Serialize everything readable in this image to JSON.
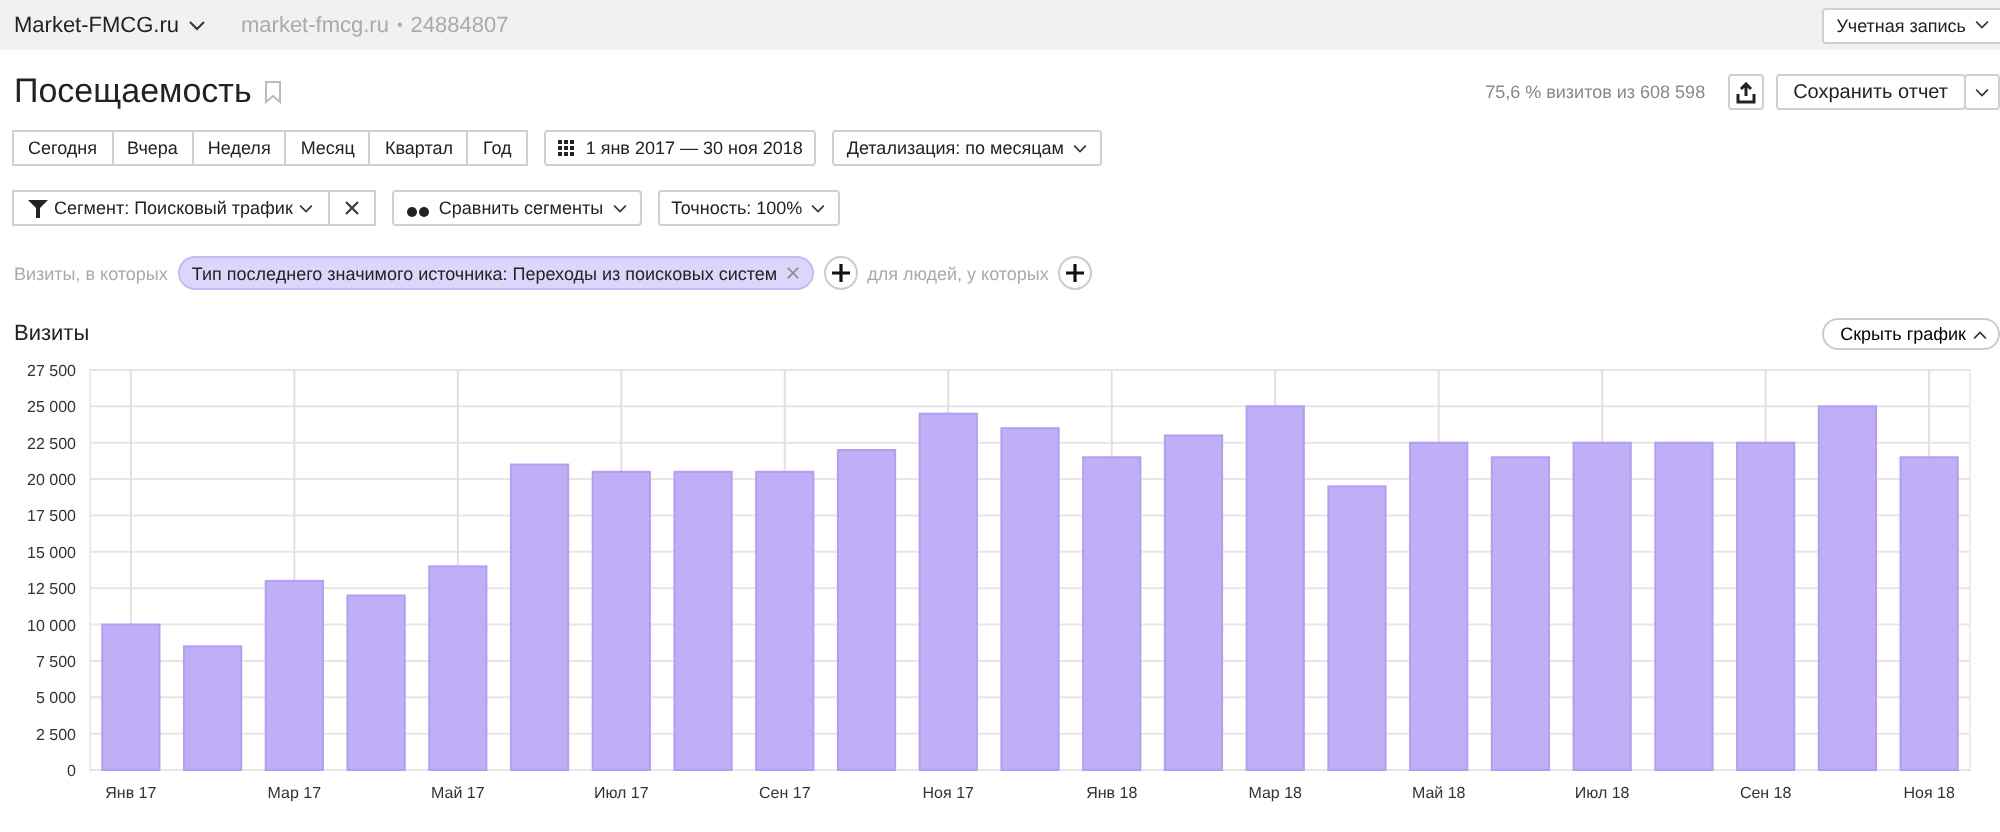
{
  "top_bar": {
    "site": "Market-FMCG.ru",
    "site_url": "market-fmcg.ru",
    "separator": "•",
    "counter_id": "24884807",
    "account_button": "Учетная запись"
  },
  "title": "Посещаемость",
  "summary": "75,6 % визитов из 608 598",
  "save_button": "Сохранить отчет",
  "periods": [
    {
      "label": "Сегодня",
      "selected": false
    },
    {
      "label": "Вчера",
      "selected": false
    },
    {
      "label": "Неделя",
      "selected": false
    },
    {
      "label": "Месяц",
      "selected": false
    },
    {
      "label": "Квартал",
      "selected": false
    },
    {
      "label": "Год",
      "selected": false
    }
  ],
  "date_range": "1 янв 2017 — 30 ноя 2018",
  "detail": "Детализация: по месяцам",
  "segment": "Сегмент: Поисковый трафик",
  "compare": "Сравнить сегменты",
  "accuracy": "Точность: 100%",
  "filter": {
    "prefix": "Визиты, в которых",
    "tag": "Тип последнего значимого источника: Переходы из поисковых систем",
    "people": "для людей, у которых"
  },
  "chart_section": {
    "title": "Визиты",
    "hide_button": "Скрыть график",
    "chart_data": {
      "type": "bar",
      "grid": true,
      "categories": [
        "Янв 17",
        null,
        "Мар 17",
        null,
        "Май 17",
        null,
        "Июл 17",
        null,
        "Сен 17",
        null,
        "Ноя 17",
        null,
        "Янв 18",
        null,
        "Мар 18",
        null,
        "Май 18",
        null,
        "Июл 18",
        null,
        "Сен 18",
        null,
        "Ноя 18"
      ],
      "ylim": [
        0,
        27500
      ],
      "yticks": [
        {
          "value": 0,
          "label": "0"
        },
        {
          "value": 2500,
          "label": "2 500"
        },
        {
          "value": 5000,
          "label": "5 000"
        },
        {
          "value": 7500,
          "label": "7 500"
        },
        {
          "value": 10000,
          "label": "10 000"
        },
        {
          "value": 12500,
          "label": "12 500"
        },
        {
          "value": 15000,
          "label": "15 000"
        },
        {
          "value": 17500,
          "label": "17 500"
        },
        {
          "value": 20000,
          "label": "20 000"
        },
        {
          "value": 22500,
          "label": "22 500"
        },
        {
          "value": 25000,
          "label": "25 000"
        },
        {
          "value": 27500,
          "label": "27 500"
        }
      ],
      "series": [
        {
          "color": "#c0aff7",
          "values": [
            10000,
            8500,
            13000,
            12000,
            14000,
            21000,
            20500,
            20500,
            20500,
            22000,
            24500,
            23500,
            21500,
            23000,
            25000,
            19500,
            22500,
            21500,
            22500,
            22500,
            22500,
            25000,
            21500
          ]
        }
      ]
    }
  }
}
